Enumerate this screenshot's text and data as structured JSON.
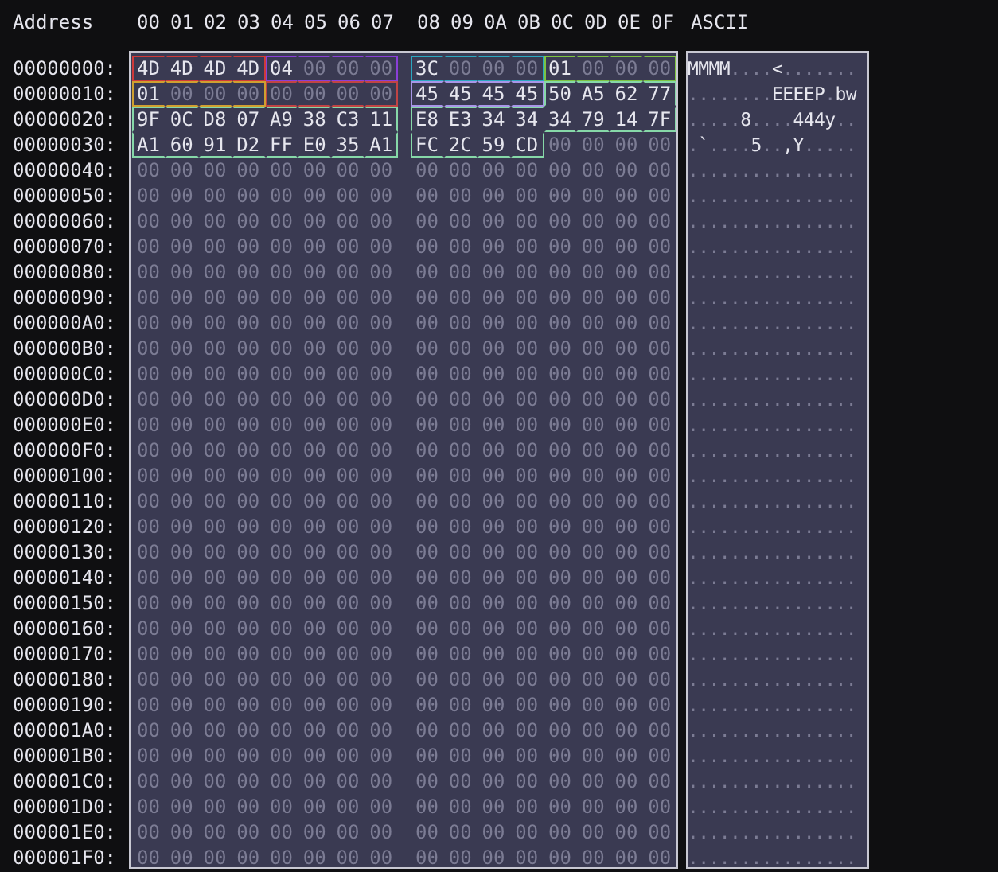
{
  "header": {
    "address_label": "Address",
    "columns": [
      "00",
      "01",
      "02",
      "03",
      "04",
      "05",
      "06",
      "07",
      "08",
      "09",
      "0A",
      "0B",
      "0C",
      "0D",
      "0E",
      "0F"
    ],
    "ascii_label": "ASCII"
  },
  "rows": [
    {
      "address": "00000000:",
      "ascii": "MMMM....<.......",
      "bytes": [
        {
          "value": "4D",
          "color": "#d03a3a"
        },
        {
          "value": "4D",
          "color": "#d03a3a"
        },
        {
          "value": "4D",
          "color": "#d03a3a"
        },
        {
          "value": "4D",
          "color": "#d03a3a"
        },
        {
          "value": "04",
          "color": "#8a3fd8"
        },
        {
          "value": "00",
          "color": "#8a3fd8"
        },
        {
          "value": "00",
          "color": "#8a3fd8"
        },
        {
          "value": "00",
          "color": "#8a3fd8"
        },
        {
          "value": "3C",
          "color": "#2aa7c0"
        },
        {
          "value": "00",
          "color": "#2aa7c0"
        },
        {
          "value": "00",
          "color": "#2aa7c0"
        },
        {
          "value": "00",
          "color": "#2aa7c0"
        },
        {
          "value": "01",
          "color": "#7cc342"
        },
        {
          "value": "00",
          "color": "#7cc342"
        },
        {
          "value": "00",
          "color": "#7cc342"
        },
        {
          "value": "00",
          "color": "#7cc342"
        }
      ]
    },
    {
      "address": "00000010:",
      "ascii": "........EEEEP.bw",
      "bytes": [
        {
          "value": "01",
          "color": "#d0a030"
        },
        {
          "value": "00",
          "color": "#d0a030"
        },
        {
          "value": "00",
          "color": "#d0a030"
        },
        {
          "value": "00",
          "color": "#d0a030"
        },
        {
          "value": "00",
          "color": "#c04444"
        },
        {
          "value": "00",
          "color": "#c04444"
        },
        {
          "value": "00",
          "color": "#c04444"
        },
        {
          "value": "00",
          "color": "#c04444"
        },
        {
          "value": "45",
          "color": "#a896e8"
        },
        {
          "value": "45",
          "color": "#a896e8"
        },
        {
          "value": "45",
          "color": "#a896e8"
        },
        {
          "value": "45",
          "color": "#a896e8"
        },
        {
          "value": "50",
          "color": "#86d8a8"
        },
        {
          "value": "A5",
          "color": "#86d8a8"
        },
        {
          "value": "62",
          "color": "#86d8a8"
        },
        {
          "value": "77",
          "color": "#86d8a8"
        }
      ]
    },
    {
      "address": "00000020:",
      "ascii": ".....8....444y..",
      "bytes": [
        {
          "value": "9F",
          "color": "#86d8a8"
        },
        {
          "value": "0C",
          "color": "#86d8a8"
        },
        {
          "value": "D8",
          "color": "#86d8a8"
        },
        {
          "value": "07",
          "color": "#86d8a8"
        },
        {
          "value": "A9",
          "color": "#86d8a8"
        },
        {
          "value": "38",
          "color": "#86d8a8"
        },
        {
          "value": "C3",
          "color": "#86d8a8"
        },
        {
          "value": "11",
          "color": "#86d8a8"
        },
        {
          "value": "E8",
          "color": "#86d8a8"
        },
        {
          "value": "E3",
          "color": "#86d8a8"
        },
        {
          "value": "34",
          "color": "#86d8a8"
        },
        {
          "value": "34",
          "color": "#86d8a8"
        },
        {
          "value": "34",
          "color": "#86d8a8"
        },
        {
          "value": "79",
          "color": "#86d8a8"
        },
        {
          "value": "14",
          "color": "#86d8a8"
        },
        {
          "value": "7F",
          "color": "#86d8a8"
        }
      ]
    },
    {
      "address": "00000030:",
      "ascii": ".`....5..,Y.....",
      "bytes": [
        {
          "value": "A1",
          "color": "#86d8a8"
        },
        {
          "value": "60",
          "color": "#86d8a8"
        },
        {
          "value": "91",
          "color": "#86d8a8"
        },
        {
          "value": "D2",
          "color": "#86d8a8"
        },
        {
          "value": "FF",
          "color": "#86d8a8"
        },
        {
          "value": "E0",
          "color": "#86d8a8"
        },
        {
          "value": "35",
          "color": "#86d8a8"
        },
        {
          "value": "A1",
          "color": "#86d8a8"
        },
        {
          "value": "FC",
          "color": "#86d8a8"
        },
        {
          "value": "2C",
          "color": "#86d8a8"
        },
        {
          "value": "59",
          "color": "#86d8a8"
        },
        {
          "value": "CD",
          "color": "#86d8a8"
        },
        {
          "value": "00"
        },
        {
          "value": "00"
        },
        {
          "value": "00"
        },
        {
          "value": "00"
        }
      ]
    },
    {
      "address": "00000040:",
      "bytes": [
        "00",
        "00",
        "00",
        "00",
        "00",
        "00",
        "00",
        "00",
        "00",
        "00",
        "00",
        "00",
        "00",
        "00",
        "00",
        "00"
      ],
      "ascii": "................"
    },
    {
      "address": "00000050:",
      "bytes": [
        "00",
        "00",
        "00",
        "00",
        "00",
        "00",
        "00",
        "00",
        "00",
        "00",
        "00",
        "00",
        "00",
        "00",
        "00",
        "00"
      ],
      "ascii": "................"
    },
    {
      "address": "00000060:",
      "bytes": [
        "00",
        "00",
        "00",
        "00",
        "00",
        "00",
        "00",
        "00",
        "00",
        "00",
        "00",
        "00",
        "00",
        "00",
        "00",
        "00"
      ],
      "ascii": "................"
    },
    {
      "address": "00000070:",
      "bytes": [
        "00",
        "00",
        "00",
        "00",
        "00",
        "00",
        "00",
        "00",
        "00",
        "00",
        "00",
        "00",
        "00",
        "00",
        "00",
        "00"
      ],
      "ascii": "................"
    },
    {
      "address": "00000080:",
      "bytes": [
        "00",
        "00",
        "00",
        "00",
        "00",
        "00",
        "00",
        "00",
        "00",
        "00",
        "00",
        "00",
        "00",
        "00",
        "00",
        "00"
      ],
      "ascii": "................"
    },
    {
      "address": "00000090:",
      "bytes": [
        "00",
        "00",
        "00",
        "00",
        "00",
        "00",
        "00",
        "00",
        "00",
        "00",
        "00",
        "00",
        "00",
        "00",
        "00",
        "00"
      ],
      "ascii": "................"
    },
    {
      "address": "000000A0:",
      "bytes": [
        "00",
        "00",
        "00",
        "00",
        "00",
        "00",
        "00",
        "00",
        "00",
        "00",
        "00",
        "00",
        "00",
        "00",
        "00",
        "00"
      ],
      "ascii": "................"
    },
    {
      "address": "000000B0:",
      "bytes": [
        "00",
        "00",
        "00",
        "00",
        "00",
        "00",
        "00",
        "00",
        "00",
        "00",
        "00",
        "00",
        "00",
        "00",
        "00",
        "00"
      ],
      "ascii": "................"
    },
    {
      "address": "000000C0:",
      "bytes": [
        "00",
        "00",
        "00",
        "00",
        "00",
        "00",
        "00",
        "00",
        "00",
        "00",
        "00",
        "00",
        "00",
        "00",
        "00",
        "00"
      ],
      "ascii": "................"
    },
    {
      "address": "000000D0:",
      "bytes": [
        "00",
        "00",
        "00",
        "00",
        "00",
        "00",
        "00",
        "00",
        "00",
        "00",
        "00",
        "00",
        "00",
        "00",
        "00",
        "00"
      ],
      "ascii": "................"
    },
    {
      "address": "000000E0:",
      "bytes": [
        "00",
        "00",
        "00",
        "00",
        "00",
        "00",
        "00",
        "00",
        "00",
        "00",
        "00",
        "00",
        "00",
        "00",
        "00",
        "00"
      ],
      "ascii": "................"
    },
    {
      "address": "000000F0:",
      "bytes": [
        "00",
        "00",
        "00",
        "00",
        "00",
        "00",
        "00",
        "00",
        "00",
        "00",
        "00",
        "00",
        "00",
        "00",
        "00",
        "00"
      ],
      "ascii": "................"
    },
    {
      "address": "00000100:",
      "bytes": [
        "00",
        "00",
        "00",
        "00",
        "00",
        "00",
        "00",
        "00",
        "00",
        "00",
        "00",
        "00",
        "00",
        "00",
        "00",
        "00"
      ],
      "ascii": "................"
    },
    {
      "address": "00000110:",
      "bytes": [
        "00",
        "00",
        "00",
        "00",
        "00",
        "00",
        "00",
        "00",
        "00",
        "00",
        "00",
        "00",
        "00",
        "00",
        "00",
        "00"
      ],
      "ascii": "................"
    },
    {
      "address": "00000120:",
      "bytes": [
        "00",
        "00",
        "00",
        "00",
        "00",
        "00",
        "00",
        "00",
        "00",
        "00",
        "00",
        "00",
        "00",
        "00",
        "00",
        "00"
      ],
      "ascii": "................"
    },
    {
      "address": "00000130:",
      "bytes": [
        "00",
        "00",
        "00",
        "00",
        "00",
        "00",
        "00",
        "00",
        "00",
        "00",
        "00",
        "00",
        "00",
        "00",
        "00",
        "00"
      ],
      "ascii": "................"
    },
    {
      "address": "00000140:",
      "bytes": [
        "00",
        "00",
        "00",
        "00",
        "00",
        "00",
        "00",
        "00",
        "00",
        "00",
        "00",
        "00",
        "00",
        "00",
        "00",
        "00"
      ],
      "ascii": "................"
    },
    {
      "address": "00000150:",
      "bytes": [
        "00",
        "00",
        "00",
        "00",
        "00",
        "00",
        "00",
        "00",
        "00",
        "00",
        "00",
        "00",
        "00",
        "00",
        "00",
        "00"
      ],
      "ascii": "................"
    },
    {
      "address": "00000160:",
      "bytes": [
        "00",
        "00",
        "00",
        "00",
        "00",
        "00",
        "00",
        "00",
        "00",
        "00",
        "00",
        "00",
        "00",
        "00",
        "00",
        "00"
      ],
      "ascii": "................"
    },
    {
      "address": "00000170:",
      "bytes": [
        "00",
        "00",
        "00",
        "00",
        "00",
        "00",
        "00",
        "00",
        "00",
        "00",
        "00",
        "00",
        "00",
        "00",
        "00",
        "00"
      ],
      "ascii": "................"
    },
    {
      "address": "00000180:",
      "bytes": [
        "00",
        "00",
        "00",
        "00",
        "00",
        "00",
        "00",
        "00",
        "00",
        "00",
        "00",
        "00",
        "00",
        "00",
        "00",
        "00"
      ],
      "ascii": "................"
    },
    {
      "address": "00000190:",
      "bytes": [
        "00",
        "00",
        "00",
        "00",
        "00",
        "00",
        "00",
        "00",
        "00",
        "00",
        "00",
        "00",
        "00",
        "00",
        "00",
        "00"
      ],
      "ascii": "................"
    },
    {
      "address": "000001A0:",
      "bytes": [
        "00",
        "00",
        "00",
        "00",
        "00",
        "00",
        "00",
        "00",
        "00",
        "00",
        "00",
        "00",
        "00",
        "00",
        "00",
        "00"
      ],
      "ascii": "................"
    },
    {
      "address": "000001B0:",
      "bytes": [
        "00",
        "00",
        "00",
        "00",
        "00",
        "00",
        "00",
        "00",
        "00",
        "00",
        "00",
        "00",
        "00",
        "00",
        "00",
        "00"
      ],
      "ascii": "................"
    },
    {
      "address": "000001C0:",
      "bytes": [
        "00",
        "00",
        "00",
        "00",
        "00",
        "00",
        "00",
        "00",
        "00",
        "00",
        "00",
        "00",
        "00",
        "00",
        "00",
        "00"
      ],
      "ascii": "................"
    },
    {
      "address": "000001D0:",
      "bytes": [
        "00",
        "00",
        "00",
        "00",
        "00",
        "00",
        "00",
        "00",
        "00",
        "00",
        "00",
        "00",
        "00",
        "00",
        "00",
        "00"
      ],
      "ascii": "................"
    },
    {
      "address": "000001E0:",
      "bytes": [
        "00",
        "00",
        "00",
        "00",
        "00",
        "00",
        "00",
        "00",
        "00",
        "00",
        "00",
        "00",
        "00",
        "00",
        "00",
        "00"
      ],
      "ascii": "................"
    },
    {
      "address": "000001F0:",
      "bytes": [
        "00",
        "00",
        "00",
        "00",
        "00",
        "00",
        "00",
        "00",
        "00",
        "00",
        "00",
        "00",
        "00",
        "00",
        "00",
        "00"
      ],
      "ascii": "................"
    }
  ]
}
